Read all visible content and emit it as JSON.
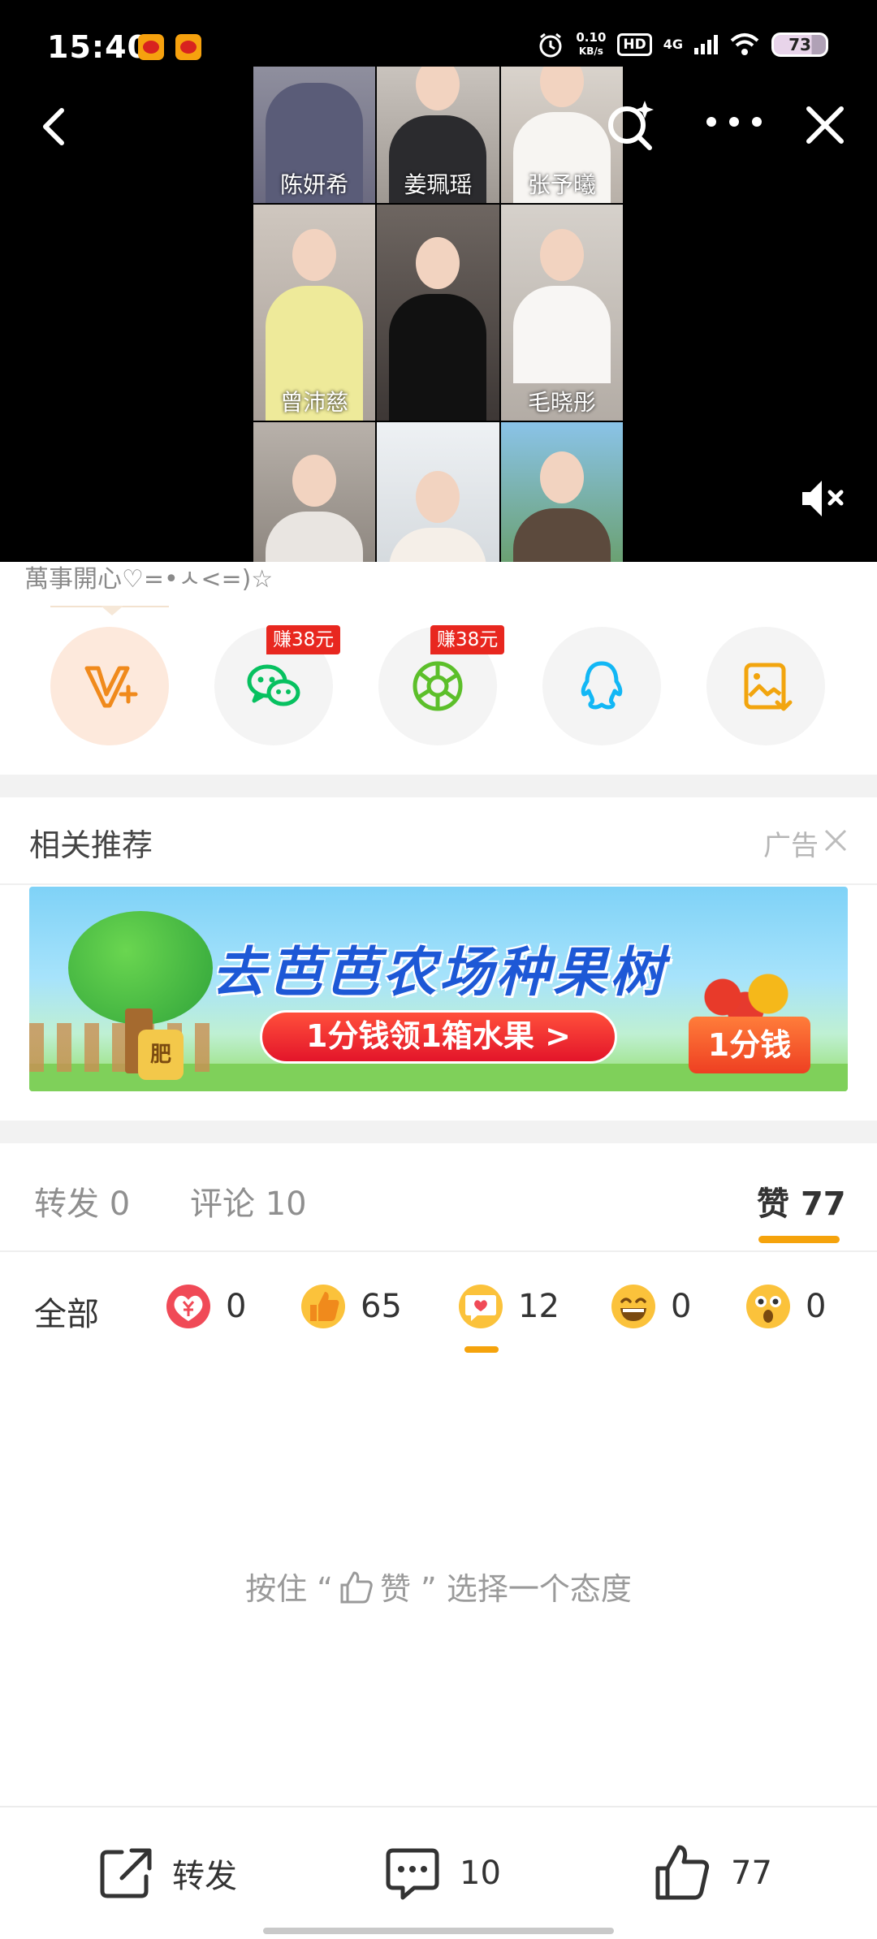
{
  "status_bar": {
    "time": "15:40",
    "net_speed_value": "0.10",
    "net_speed_unit": "KB/s",
    "hd": "HD",
    "network": "4G",
    "battery": "73"
  },
  "video": {
    "names": [
      "陈妍希",
      "姜珮瑶",
      "张予曦",
      "曾沛慈",
      "毛晓彤"
    ],
    "icons": [
      "back-icon",
      "search-spark-icon",
      "more-icon",
      "close-icon",
      "mute-icon"
    ]
  },
  "caption": "萬事開心♡=•ㅅ<=)☆",
  "share": {
    "badges": [
      "赚38元",
      "赚38元"
    ]
  },
  "recommend": {
    "title": "相关推荐",
    "ad_label": "广告",
    "banner_title": "去芭芭农场种果树",
    "banner_cta": "1分钱领1箱水果 >",
    "banner_price": "1分钱",
    "banner_bag": "肥"
  },
  "tabs": {
    "repost_label": "转发",
    "repost_count": "0",
    "comment_label": "评论",
    "comment_count": "10",
    "like_label": "赞",
    "like_count": "77"
  },
  "reactions": {
    "all_label": "全部",
    "items": [
      {
        "icon": "heart-coin-icon",
        "count": "0"
      },
      {
        "icon": "thumbs-up-icon",
        "count": "65"
      },
      {
        "icon": "heart-bubble-icon",
        "count": "12"
      },
      {
        "icon": "laughing-face-icon",
        "count": "0"
      },
      {
        "icon": "surprised-face-icon",
        "count": "0"
      }
    ]
  },
  "hint": {
    "prefix": "按住 “",
    "word": "赞",
    "suffix": "” 选择一个态度"
  },
  "bottom_bar": {
    "repost_label": "转发",
    "comment_count": "10",
    "like_count": "77"
  },
  "colors": {
    "accent_orange": "#f5a30c",
    "badge_red": "#e8271f",
    "wechat_green": "#07c160",
    "qq_blue": "#12b7f5"
  }
}
